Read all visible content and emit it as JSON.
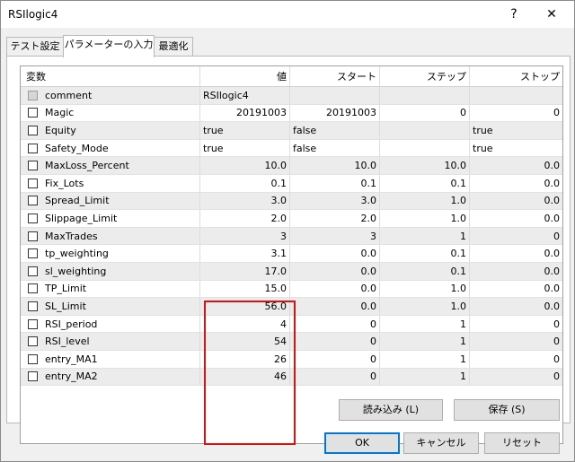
{
  "window": {
    "title": "RSIlogic4",
    "help_label": "?",
    "close_label": "✕"
  },
  "tabs": [
    {
      "label": "テスト設定"
    },
    {
      "label": "パラメーターの入力"
    },
    {
      "label": "最適化"
    }
  ],
  "table": {
    "headers": [
      "変数",
      "値",
      "スタート",
      "ステップ",
      "ストップ"
    ],
    "rows": [
      {
        "name": "comment",
        "value": "RSIlogic4",
        "start": "",
        "step": "",
        "stop": ""
      },
      {
        "name": "Magic",
        "value": "20191003",
        "start": "20191003",
        "step": "0",
        "stop": "0"
      },
      {
        "name": "Equity",
        "value": "true",
        "start": "false",
        "step": "",
        "stop": "true"
      },
      {
        "name": "Safety_Mode",
        "value": "true",
        "start": "false",
        "step": "",
        "stop": "true"
      },
      {
        "name": "MaxLoss_Percent",
        "value": "10.0",
        "start": "10.0",
        "step": "10.0",
        "stop": "0.0"
      },
      {
        "name": "Fix_Lots",
        "value": "0.1",
        "start": "0.1",
        "step": "0.1",
        "stop": "0.0"
      },
      {
        "name": "Spread_Limit",
        "value": "3.0",
        "start": "3.0",
        "step": "1.0",
        "stop": "0.0"
      },
      {
        "name": "Slippage_Limit",
        "value": "2.0",
        "start": "2.0",
        "step": "1.0",
        "stop": "0.0"
      },
      {
        "name": "MaxTrades",
        "value": "3",
        "start": "3",
        "step": "1",
        "stop": "0"
      },
      {
        "name": "tp_weighting",
        "value": "3.1",
        "start": "0.0",
        "step": "0.1",
        "stop": "0.0"
      },
      {
        "name": "sl_weighting",
        "value": "17.0",
        "start": "0.0",
        "step": "0.1",
        "stop": "0.0"
      },
      {
        "name": "TP_Limit",
        "value": "15.0",
        "start": "0.0",
        "step": "1.0",
        "stop": "0.0"
      },
      {
        "name": "SL_Limit",
        "value": "56.0",
        "start": "0.0",
        "step": "1.0",
        "stop": "0.0"
      },
      {
        "name": "RSI_period",
        "value": "4",
        "start": "0",
        "step": "1",
        "stop": "0"
      },
      {
        "name": "RSI_level",
        "value": "54",
        "start": "0",
        "step": "1",
        "stop": "0"
      },
      {
        "name": "entry_MA1",
        "value": "26",
        "start": "0",
        "step": "1",
        "stop": "0"
      },
      {
        "name": "entry_MA2",
        "value": "46",
        "start": "0",
        "step": "1",
        "stop": "0"
      }
    ]
  },
  "buttons": {
    "load": "読み込み (L)",
    "save": "保存 (S)",
    "ok": "OK",
    "cancel": "キャンセル",
    "reset": "リセット"
  }
}
